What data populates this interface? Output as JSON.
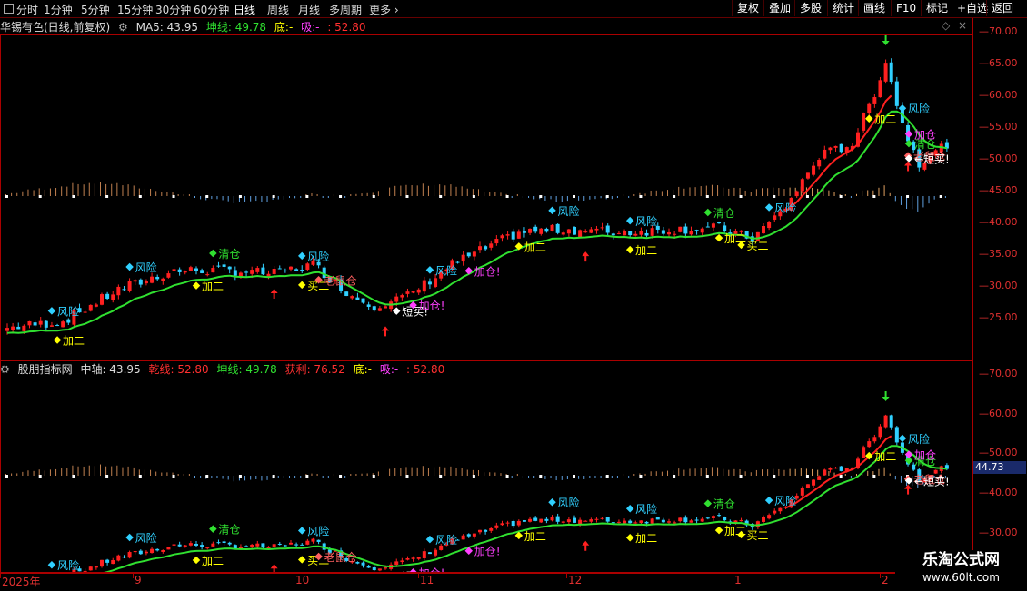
{
  "toolbar": {
    "periods": [
      "分时",
      "1分钟",
      "5分钟",
      "15分钟",
      "30分钟",
      "60分钟",
      "日线",
      "周线",
      "月线",
      "多周期",
      "更多"
    ],
    "active_period": "日线",
    "right_buttons": [
      "复权",
      "叠加",
      "多股",
      "统计",
      "画线",
      "F10",
      "标记",
      "+自选",
      "返回"
    ]
  },
  "panel1": {
    "stock_name": "华锡有色(日线,前复权)",
    "ma5": "MA5: 43.95",
    "kun": "坤线: 49.78",
    "di": "底:-",
    "xi": "吸:-",
    "extra": ": 52.80"
  },
  "panel2": {
    "indicator_name": "股朋指标网",
    "zhongzhou": "中轴: 43.95",
    "qian": "乾线: 52.80",
    "kun": "坤线: 49.78",
    "huoli": "获利: 76.52",
    "di": "底:-",
    "xi": "吸:-",
    "extra": ": 52.80"
  },
  "axis1_ticks": [
    "70.00",
    "65.00",
    "60.00",
    "55.00",
    "50.00",
    "45.00",
    "40.00",
    "35.00",
    "30.00",
    "25.00"
  ],
  "axis2_ticks": [
    "70.00",
    "60.00",
    "50.00",
    "40.00",
    "30.00"
  ],
  "current_price_label": "44.73",
  "dates": [
    "2025年",
    "9",
    "10",
    "11",
    "12",
    "1",
    "2"
  ],
  "signal_labels": [
    "风险",
    "加二",
    "清仓",
    "买二",
    "老鼠仓",
    "短买!",
    "加仓!",
    "加仓",
    "←短买!"
  ],
  "colors": {
    "up": "#ff2020",
    "down": "#30d0ff",
    "kun": "#30e030",
    "frame": "#aa0000",
    "tick": "#e03030"
  },
  "watermark": {
    "title": "乐淘公式网",
    "url": "www.60lt.com"
  }
}
